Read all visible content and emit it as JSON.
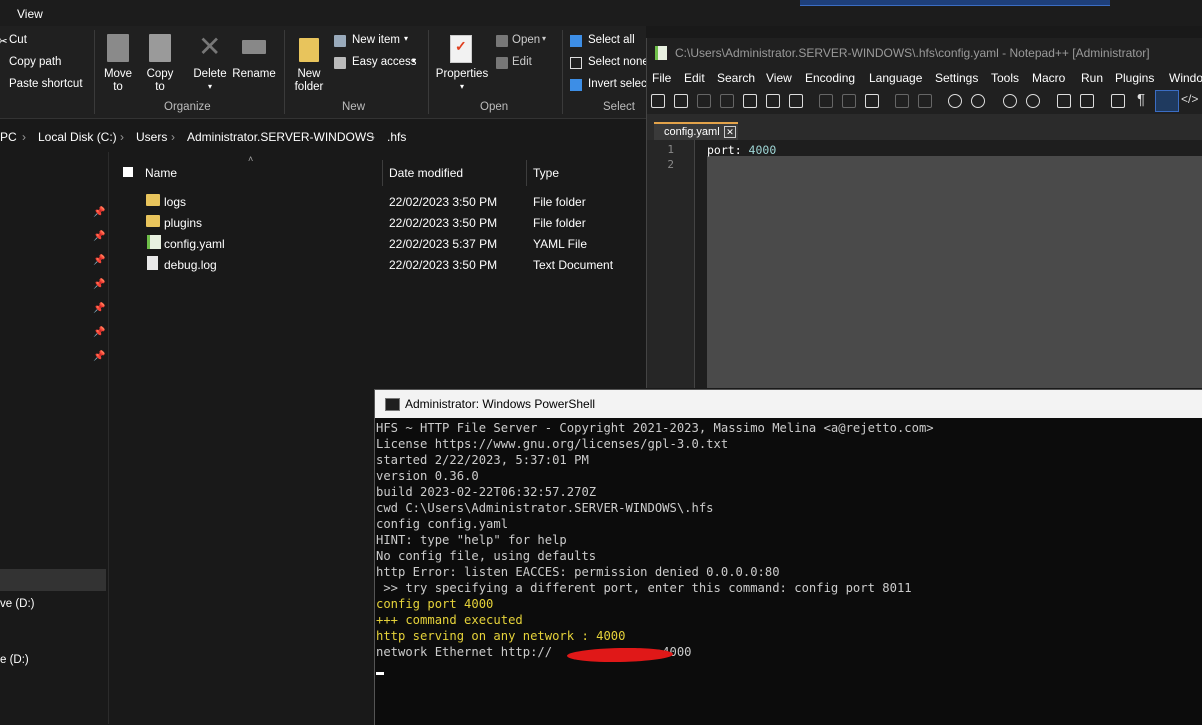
{
  "explorer": {
    "menu_view": "View",
    "ribbon": {
      "clipboard": {
        "cut": "Cut",
        "copy_path": "Copy path",
        "paste_shortcut": "Paste shortcut"
      },
      "organize": {
        "move_to": "Move\nto",
        "copy_to": "Copy\nto",
        "delete": "Delete",
        "rename": "Rename",
        "group": "Organize"
      },
      "new": {
        "new_folder": "New\nfolder",
        "new_item": "New item",
        "easy_access": "Easy access",
        "group": "New"
      },
      "open": {
        "properties": "Properties",
        "open": "Open",
        "edit": "Edit",
        "group": "Open"
      },
      "select": {
        "select_all": "Select all",
        "select_none": "Select none",
        "invert_selection": "Invert selection",
        "group": "Select"
      }
    },
    "breadcrumb": [
      "PC",
      "Local Disk (C:)",
      "Users",
      "Administrator.SERVER-WINDOWS",
      ".hfs"
    ],
    "nav": {
      "drive1": "ve (D:)",
      "drive2": "e (D:)"
    },
    "columns": {
      "name": "Name",
      "date": "Date modified",
      "type": "Type"
    },
    "files": [
      {
        "name": "logs",
        "date": "22/02/2023 3:50 PM",
        "type": "File folder",
        "icon": "folder-icon"
      },
      {
        "name": "plugins",
        "date": "22/02/2023 3:50 PM",
        "type": "File folder",
        "icon": "folder-icon"
      },
      {
        "name": "config.yaml",
        "date": "22/02/2023 5:37 PM",
        "type": "YAML File",
        "icon": "yaml-file-icon"
      },
      {
        "name": "debug.log",
        "date": "22/02/2023 3:50 PM",
        "type": "Text Document",
        "icon": "text-file-icon"
      }
    ]
  },
  "notepadpp": {
    "title": "C:\\Users\\Administrator.SERVER-WINDOWS\\.hfs\\config.yaml - Notepad++ [Administrator]",
    "menu": [
      "File",
      "Edit",
      "Search",
      "View",
      "Encoding",
      "Language",
      "Settings",
      "Tools",
      "Macro",
      "Run",
      "Plugins",
      "Window"
    ],
    "tab": "config.yaml",
    "line_numbers": [
      "1",
      "2"
    ],
    "content_key": "port:",
    "content_value": " 4000"
  },
  "powershell": {
    "title": "Administrator: Windows PowerShell",
    "lines": [
      {
        "text": "HFS ~ HTTP File Server - Copyright 2021-2023, Massimo Melina <a@rejetto.com>",
        "color": "white"
      },
      {
        "text": "License https://www.gnu.org/licenses/gpl-3.0.txt",
        "color": "white"
      },
      {
        "text": "started 2/22/2023, 5:37:01 PM",
        "color": "white"
      },
      {
        "text": "version 0.36.0",
        "color": "white"
      },
      {
        "text": "build 2023-02-22T06:32:57.270Z",
        "color": "white"
      },
      {
        "text": "cwd C:\\Users\\Administrator.SERVER-WINDOWS\\.hfs",
        "color": "white"
      },
      {
        "text": "config config.yaml",
        "color": "white"
      },
      {
        "text": "HINT: type \"help\" for help",
        "color": "white"
      },
      {
        "text": "No config file, using defaults",
        "color": "white"
      },
      {
        "text": "http Error: listen EACCES: permission denied 0.0.0.0:80",
        "color": "white"
      },
      {
        "text": " >> try specifying a different port, enter this command: config port 8011",
        "color": "white"
      },
      {
        "text": "config port 4000",
        "color": "yellow"
      },
      {
        "text": "+++ command executed",
        "color": "yellow"
      },
      {
        "text": "http serving on any network : 4000",
        "color": "yellow"
      },
      {
        "text": "network Ethernet http://              :4000",
        "color": "white"
      }
    ]
  }
}
